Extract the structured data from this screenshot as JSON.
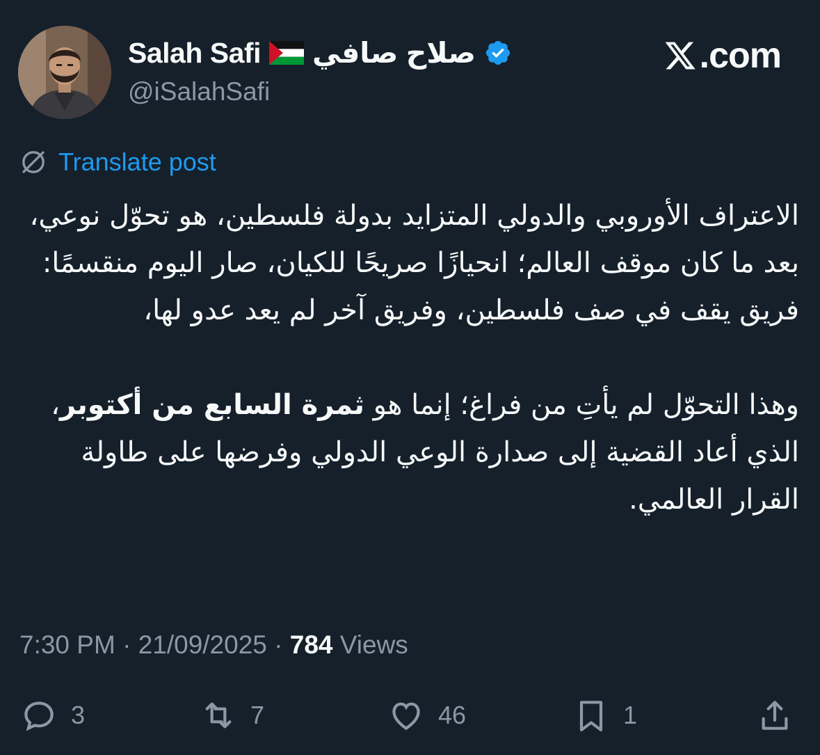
{
  "author": {
    "display_name_en": "Salah Safi",
    "display_name_ar": "صلاح صافي",
    "handle": "@iSalahSafi",
    "verified": true
  },
  "brand": {
    "label": ".com"
  },
  "translate": {
    "label": "Translate post"
  },
  "post": {
    "paragraph1": "الاعتراف الأوروبي والدولي المتزايد بدولة فلسطين، هو تحوّل نوعي، بعد ما كان موقف العالم؛ انحيازًا صريحًا للكيان، صار اليوم منقسمًا: فريق يقف في صف فلسطين، وفريق آخر لم يعد عدو لها،",
    "paragraph2_before": "وهذا التحوّل لم يأتِ من فراغ؛ إنما هو ",
    "paragraph2_bold": "ثمرة السابع من أكتوبر",
    "paragraph2_after": "، الذي أعاد القضية إلى صدارة الوعي الدولي وفرضها على طاولة القرار العالمي."
  },
  "meta": {
    "time": "7:30 PM",
    "separator": "·",
    "date": "21/09/2025",
    "views_count": "784",
    "views_label": "Views"
  },
  "actions": {
    "replies": "3",
    "reposts": "7",
    "likes": "46",
    "bookmarks": "1"
  },
  "colors": {
    "background": "#15202b",
    "text": "#f7f9f9",
    "secondary": "#8b98a5",
    "accent": "#1d9bf0",
    "flag_red": "#ce1126",
    "flag_green": "#009736"
  }
}
